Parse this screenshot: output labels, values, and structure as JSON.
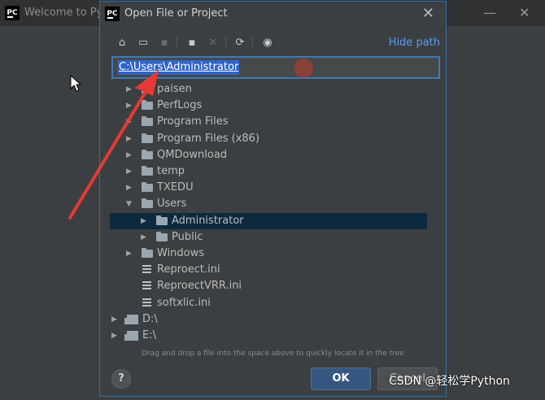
{
  "background": {
    "title": "Welcome to PyC",
    "minimize": "—",
    "close": "✕"
  },
  "dialog": {
    "logo": "PC",
    "title": "Open File or Project",
    "close": "✕",
    "toolbar": {
      "home": "⌂",
      "desktop": "▭",
      "project": "▪",
      "new_folder": "▪",
      "delete": "✕",
      "refresh": "⟳",
      "show_hidden": "◉",
      "hide_path": "Hide path"
    },
    "path_value": "C:\\Users\\Administrator",
    "tree": [
      {
        "label": "paisen",
        "kind": "folder",
        "expand": "▶"
      },
      {
        "label": "PerfLogs",
        "kind": "folder",
        "expand": "▶"
      },
      {
        "label": "Program Files",
        "kind": "folder",
        "expand": "▶"
      },
      {
        "label": "Program Files (x86)",
        "kind": "folder",
        "expand": "▶"
      },
      {
        "label": "QMDownload",
        "kind": "folder",
        "expand": "▶"
      },
      {
        "label": "temp",
        "kind": "folder",
        "expand": "▶"
      },
      {
        "label": "TXEDU",
        "kind": "folder",
        "expand": "▶"
      },
      {
        "label": "Users",
        "kind": "folder",
        "expand": "▼"
      },
      {
        "label": "Administrator",
        "kind": "folder",
        "expand": "▶",
        "selected": true
      },
      {
        "label": "Public",
        "kind": "folder",
        "expand": "▶"
      },
      {
        "label": "Windows",
        "kind": "folder",
        "expand": "▶"
      },
      {
        "label": "Reproect.ini",
        "kind": "file"
      },
      {
        "label": "ReproectVRR.ini",
        "kind": "file"
      },
      {
        "label": "softxlic.ini",
        "kind": "file"
      },
      {
        "label": "D:\\",
        "kind": "drive",
        "expand": "▶"
      },
      {
        "label": "E:\\",
        "kind": "drive",
        "expand": "▶"
      }
    ],
    "hint": "Drag and drop a file into the space above to quickly locate it in the tree",
    "help": "?",
    "ok": "OK",
    "cancel": "Cancel"
  },
  "watermark": "CSDN @轻松学Python",
  "colors": {
    "accent": "#589df6",
    "selection": "#0d293e",
    "ok_button": "#365880",
    "annotation_arrow": "#e53935"
  }
}
